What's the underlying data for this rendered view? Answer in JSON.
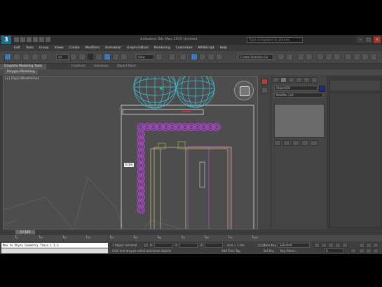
{
  "app": {
    "logo": "3",
    "window_title": "Autodesk 3ds Max 2015   Untitled",
    "search_placeholder": "Type a keyword or phrase"
  },
  "menu": [
    "Edit",
    "Tools",
    "Group",
    "Views",
    "Create",
    "Modifiers",
    "Animation",
    "Graph Editors",
    "Rendering",
    "Customize",
    "MAXScript",
    "Help"
  ],
  "toolbar": {
    "selection_filter": "All",
    "ref_coord": "View",
    "named_selection": "Create Selection Se"
  },
  "ribbon": {
    "tabs": [
      "Graphite Modeling Tools",
      "Freeform",
      "Selection",
      "Object Paint"
    ],
    "active_tab": "Graphite Modeling Tools",
    "panel_label": "Polygon Modeling"
  },
  "viewport": {
    "label": "[+] [Top] [Wireframe]",
    "tooltip": "0.1m",
    "wire_color": "#3ec7e0",
    "select_color": "#b344d6",
    "object_color": "#e0e0e0"
  },
  "command_panel": {
    "object_name": "Object001",
    "modifier_list": "Modifier List",
    "color": "#1a2d8a"
  },
  "timeline": {
    "slider_label": "0 / 100",
    "ticks": [
      "0",
      "10",
      "20",
      "30",
      "40",
      "50",
      "60",
      "70",
      "80",
      "90",
      "100"
    ]
  },
  "status": {
    "maxscript_text": "Max to Physx Geometry Trace 1 1.3",
    "selection_count": "1 Object Selected",
    "prompt": "Click and drag to select and move objects",
    "x_label": "X:",
    "y_label": "Y:",
    "z_label": "Z:",
    "grid": "Grid = 1.0m",
    "autokey": "Auto Key",
    "selected_dd": "Selected",
    "setkey": "Set Key",
    "key_filters": "Key Filters...",
    "add_time_tag": "Add Time Tag",
    "frame": "0"
  }
}
